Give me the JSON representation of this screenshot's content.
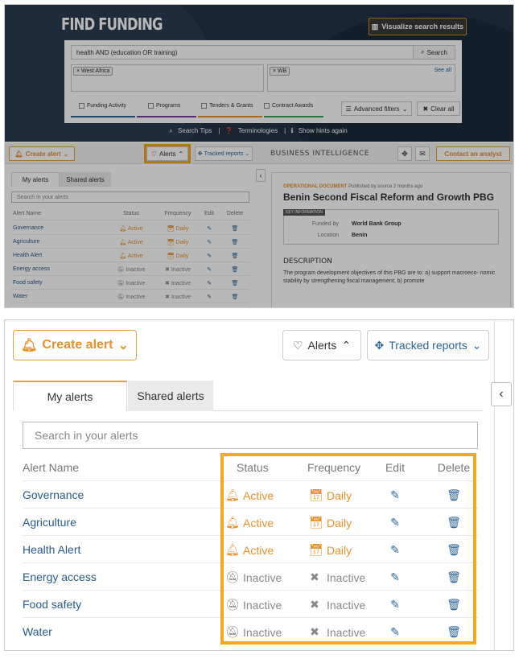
{
  "header": {
    "title": "FIND FUNDING",
    "visualize_label": "Visualize search results"
  },
  "search": {
    "query": "health AND (education OR training)",
    "button_label": "Search",
    "region_chip": "× West Africa",
    "org_chip": "× WB",
    "see_all": "See all"
  },
  "categories": [
    {
      "label": "Funding Activity",
      "color": "#2a6496"
    },
    {
      "label": "Programs",
      "color": "#7b3fa0"
    },
    {
      "label": "Tenders & Grants",
      "color": "#e8902a"
    },
    {
      "label": "Contract Awards",
      "color": "#3aa655"
    }
  ],
  "filters": {
    "advanced_label": "Advanced filters",
    "clear_label": "Clear all"
  },
  "hints": {
    "tips": "Search Tips",
    "terms": "Terminologies",
    "show_hints": "Show hints again"
  },
  "toolbar": {
    "create_alert": "Create alert",
    "alerts": "Alerts",
    "tracked_reports": "Tracked reports",
    "business_intelligence": "BUSINESS INTELLIGENCE",
    "contact": "Contact an analyst"
  },
  "alerts_panel": {
    "tab_my": "My alerts",
    "tab_shared": "Shared alerts",
    "search_placeholder": "Search in your alerts",
    "columns": {
      "name": "Alert Name",
      "status": "Status",
      "frequency": "Frequency",
      "edit": "Edit",
      "delete": "Delete"
    },
    "rows": [
      {
        "name": "Governance",
        "status": "Active",
        "frequency": "Daily"
      },
      {
        "name": "Agriculture",
        "status": "Active",
        "frequency": "Daily"
      },
      {
        "name": "Health Alert",
        "status": "Active",
        "frequency": "Daily"
      },
      {
        "name": "Energy access",
        "status": "Inactive",
        "frequency": "Inactive"
      },
      {
        "name": "Food safety",
        "status": "Inactive",
        "frequency": "Inactive"
      },
      {
        "name": "Water",
        "status": "Inactive",
        "frequency": "Inactive"
      }
    ]
  },
  "document": {
    "type": "OPERATIONAL DOCUMENT",
    "published": "Published by source 2 months ago",
    "title": "Benin Second Fiscal Reform and Growth PBG",
    "key_info_label": "KEY INFORMATION",
    "funded_by_label": "Funded by",
    "funded_by": "World Bank Group",
    "location_label": "Location",
    "location": "Benin",
    "description_heading": "DESCRIPTION",
    "description": "The program development objectives of this PBG are to: a) support macroeco- nomic stability by strengthening fiscal management; b) promote"
  },
  "colors": {
    "accent": "#e8902a",
    "highlight": "#f5a623",
    "link": "#2a5a8c",
    "hero_bg": "#243447"
  },
  "icons": {
    "bell_active": "bell-solid-icon",
    "bell_inactive": "bell-outline-icon",
    "calendar": "calendar-icon",
    "cross": "x-icon",
    "edit": "edit-icon",
    "delete": "trash-icon"
  }
}
